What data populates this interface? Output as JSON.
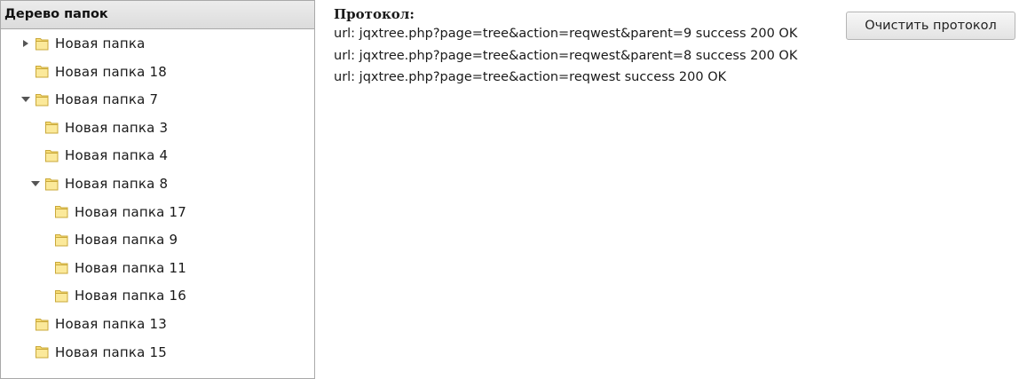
{
  "tree": {
    "title": "Дерево папок",
    "items": [
      {
        "label": "Новая папка",
        "level": 0,
        "toggle": "collapsed"
      },
      {
        "label": "Новая папка 18",
        "level": 0,
        "toggle": "none"
      },
      {
        "label": "Новая папка 7",
        "level": 0,
        "toggle": "expanded"
      },
      {
        "label": "Новая папка 3",
        "level": 1,
        "toggle": "none"
      },
      {
        "label": "Новая папка 4",
        "level": 1,
        "toggle": "none"
      },
      {
        "label": "Новая папка 8",
        "level": 1,
        "toggle": "expanded"
      },
      {
        "label": "Новая папка 17",
        "level": 2,
        "toggle": "none"
      },
      {
        "label": "Новая папка 9",
        "level": 2,
        "toggle": "none"
      },
      {
        "label": "Новая папка 11",
        "level": 2,
        "toggle": "none"
      },
      {
        "label": "Новая папка 16",
        "level": 2,
        "toggle": "none"
      },
      {
        "label": "Новая папка 13",
        "level": 0,
        "toggle": "none"
      },
      {
        "label": "Новая папка 15",
        "level": 0,
        "toggle": "none"
      }
    ],
    "icons": {
      "folder": "folder-icon",
      "expanded": "triangle-down-icon",
      "collapsed": "triangle-right-icon"
    }
  },
  "log": {
    "title": "Протокол:",
    "lines": [
      "url: jqxtree.php?page=tree&action=reqwest&parent=9 success 200 OK",
      "url: jqxtree.php?page=tree&action=reqwest&parent=8 success 200 OK",
      "url: jqxtree.php?page=tree&action=reqwest success 200 OK"
    ]
  },
  "clear_button": {
    "label": "Очистить протокол"
  },
  "colors": {
    "folder_fill": "#f7dc74",
    "folder_stroke": "#c9a83a",
    "header_bg": "#e4e4e4",
    "border": "#a9a9a9"
  }
}
